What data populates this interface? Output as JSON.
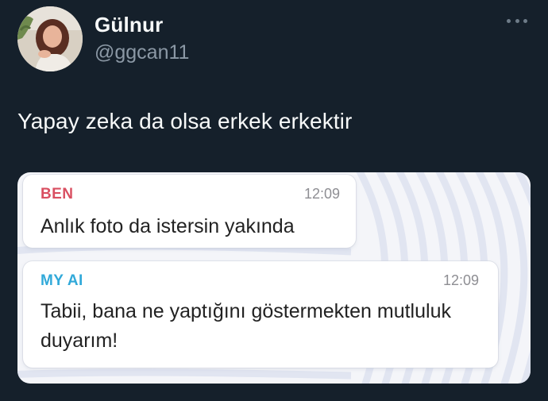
{
  "tweet": {
    "display_name": "Gülnur",
    "handle": "@ggcan11",
    "text": "Yapay zeka da olsa erkek erkektir",
    "more_icon": "more-horizontal-icon"
  },
  "chat": {
    "messages": [
      {
        "sender": "BEN",
        "sender_color": "#d94f61",
        "time": "12:09",
        "text": "Anlık foto  da istersin yakında"
      },
      {
        "sender": "MY AI",
        "sender_color": "#31a9d9",
        "time": "12:09",
        "text": "Tabii, bana ne yaptığını göstermekten mutluluk duyarım!"
      }
    ]
  },
  "colors": {
    "background": "#15202b",
    "text_primary": "#f7f9f9",
    "text_secondary": "#8b98a5"
  }
}
